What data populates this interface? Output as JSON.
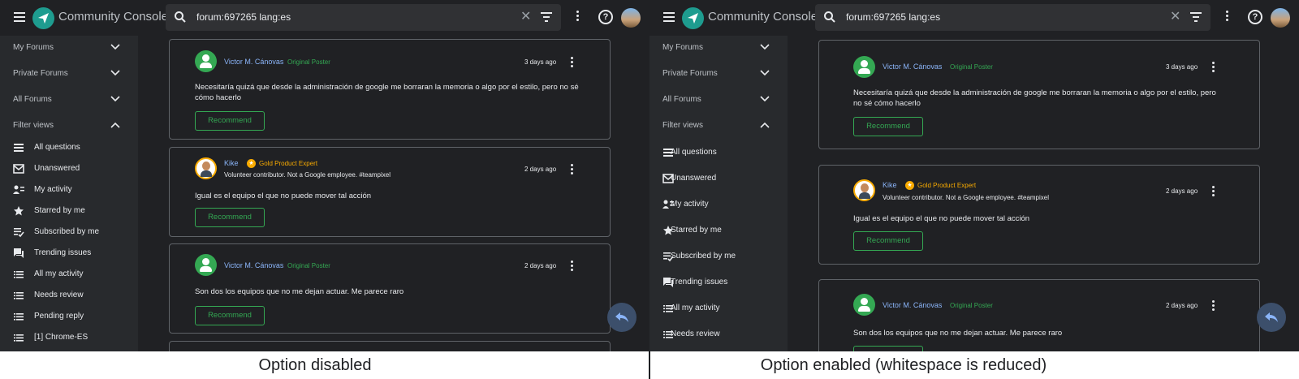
{
  "app": {
    "title": "Community Console"
  },
  "search": {
    "query": "forum:697265 lang:es",
    "clear": "✕"
  },
  "sidebar": {
    "sections": [
      {
        "label": "My Forums"
      },
      {
        "label": "Private Forums"
      },
      {
        "label": "All Forums"
      },
      {
        "label": "Filter views"
      }
    ],
    "items_left": [
      {
        "label": "All questions",
        "icon": "list-bold-icon"
      },
      {
        "label": "Unanswered",
        "icon": "mail-icon"
      },
      {
        "label": "My activity",
        "icon": "person-list-icon"
      },
      {
        "label": "Starred by me",
        "icon": "star-icon"
      },
      {
        "label": "Subscribed by me",
        "icon": "playlist-check-icon"
      },
      {
        "label": "Trending issues",
        "icon": "forum-icon"
      },
      {
        "label": "All my activity",
        "icon": "list-icon"
      },
      {
        "label": "Needs review",
        "icon": "list-icon"
      },
      {
        "label": "Pending reply",
        "icon": "list-icon"
      },
      {
        "label": "[1] Chrome-ES",
        "icon": "list-icon"
      }
    ],
    "items_right": [
      {
        "label": "All questions",
        "icon": "list-bold-icon"
      },
      {
        "label": "Unanswered",
        "icon": "mail-icon"
      },
      {
        "label": "My activity",
        "icon": "person-list-icon"
      },
      {
        "label": "Starred by me",
        "icon": "star-icon"
      },
      {
        "label": "Subscribed by me",
        "icon": "playlist-check-icon"
      },
      {
        "label": "Trending issues",
        "icon": "forum-icon"
      },
      {
        "label": "All my activity",
        "icon": "list-icon"
      },
      {
        "label": "Needs review",
        "icon": "list-icon"
      }
    ]
  },
  "replies": [
    {
      "author": "Victor M. Cánovas",
      "tag": "Original Poster",
      "time": "3 days ago",
      "body": "Necesitaría quizá que desde la administración de google me borraran la memoria o algo por el estilo, pero no sé cómo hacerlo",
      "body_line1": "Necesitaría quizá que desde la administración de google me borraran la memoria o algo por el estilo, pero no sé",
      "body_line2": "cómo hacerlo",
      "body_r_line1": "Necesitaría quizá que desde la administración de google me borraran la memoria o algo por el estilo, pero",
      "body_r_line2": "no sé cómo hacerlo",
      "button": "Recommend"
    },
    {
      "author": "Kike",
      "badge": "Gold Product Expert",
      "subtitle": "Volunteer contributor. Not a Google employee. #teampixel",
      "time": "2 days ago",
      "body": "Igual es el equipo el que no puede mover tal acción",
      "button": "Recommend"
    },
    {
      "author": "Victor M. Cánovas",
      "tag": "Original Poster",
      "time": "2 days ago",
      "body": "Son dos los equipos que no me dejan actuar. Me parece raro",
      "button": "Recommend"
    }
  ],
  "captions": {
    "left": "Option disabled",
    "right": "Option enabled (whitespace is reduced)"
  },
  "colors": {
    "background": "#202124",
    "sidebar": "#282a2d",
    "accent_green": "#34a853",
    "link_blue": "#8ab4f8",
    "gold": "#f9ab00"
  }
}
